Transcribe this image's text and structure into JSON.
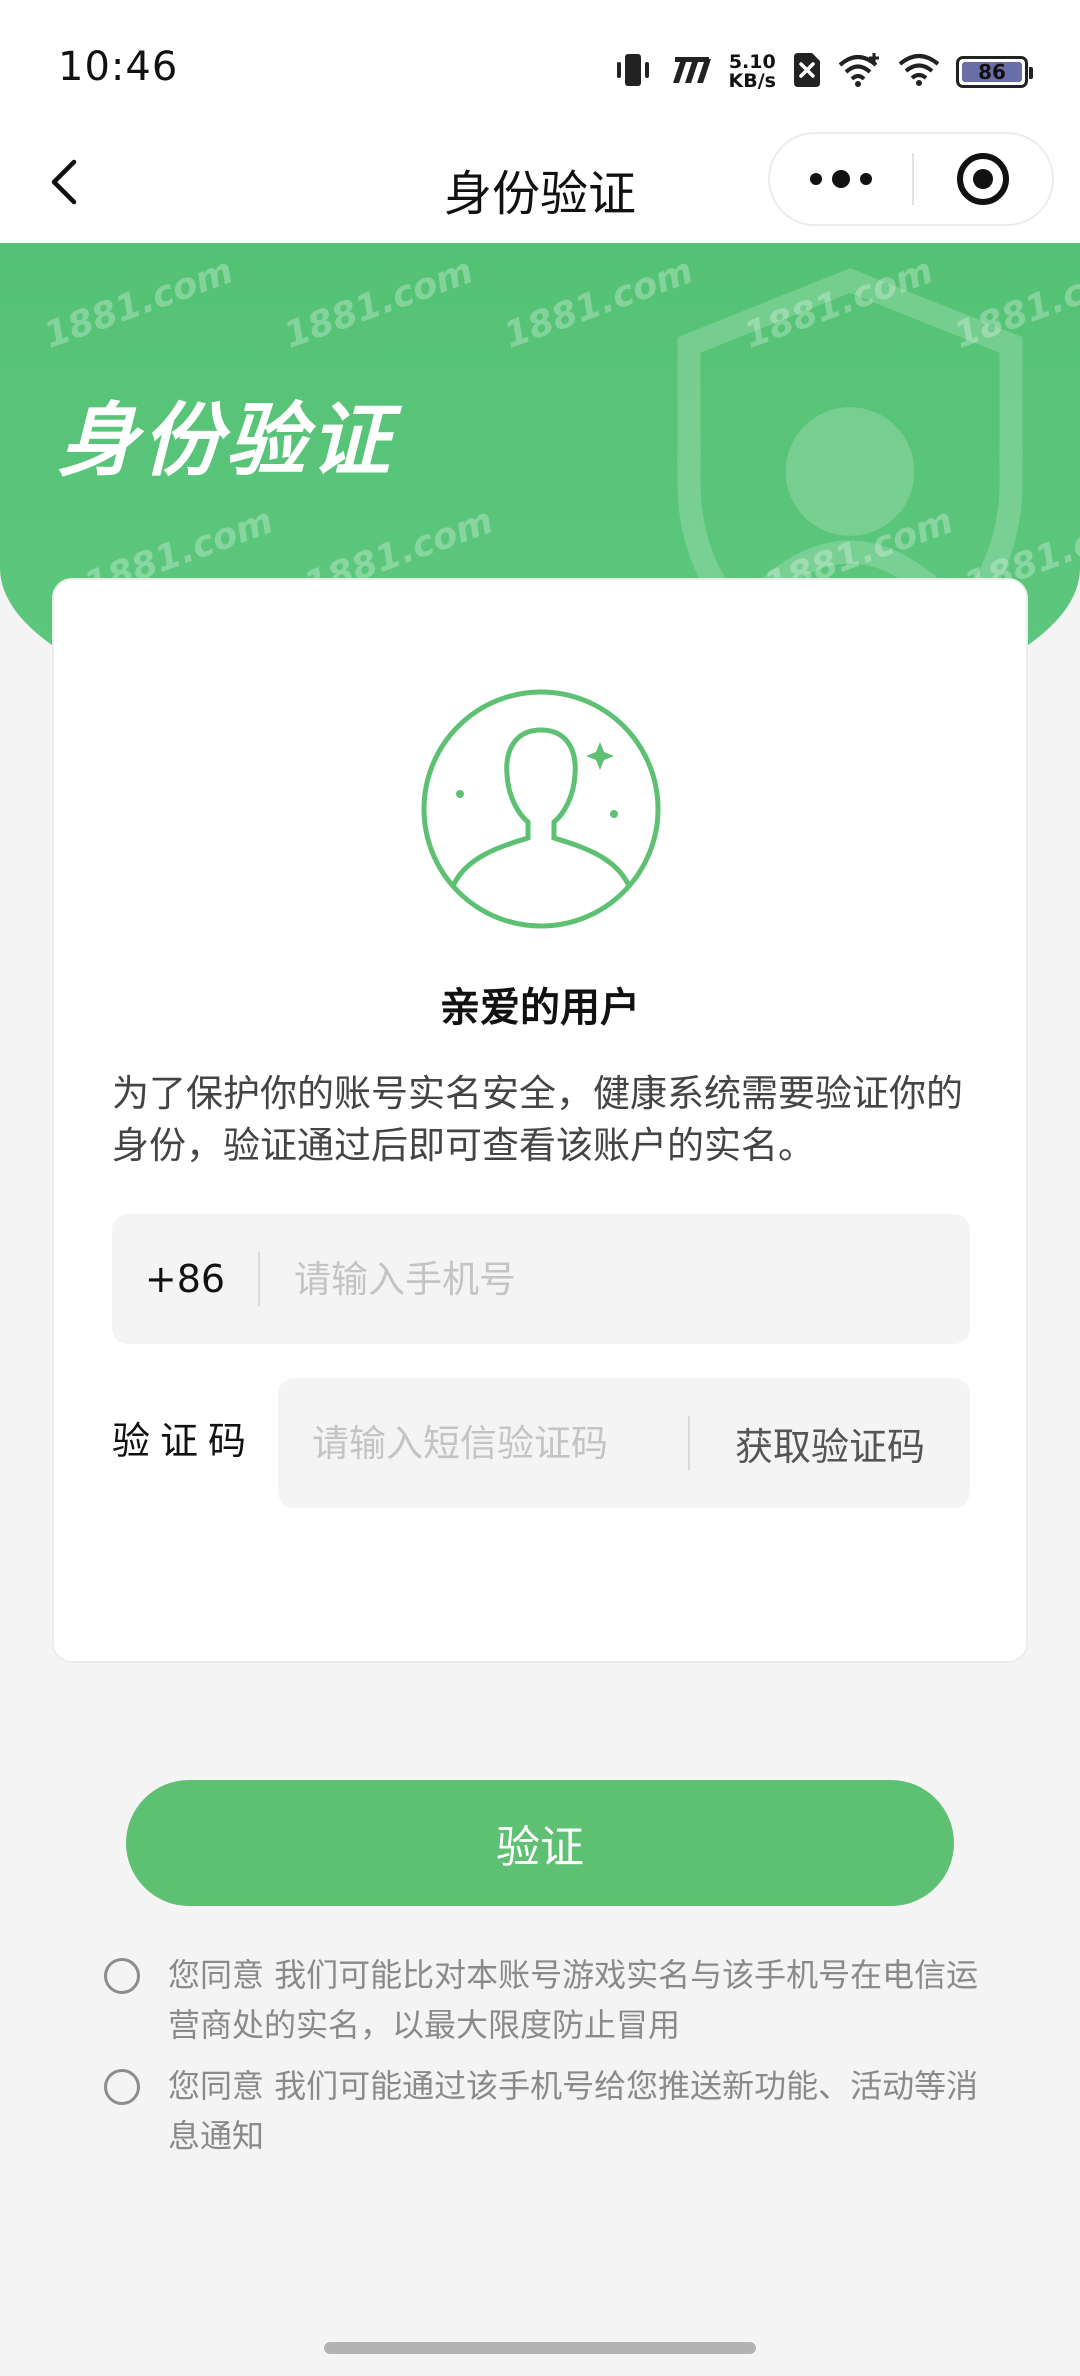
{
  "status_bar": {
    "time": "10:46",
    "net_speed_value": "5.10",
    "net_speed_unit": "KB/s",
    "battery_level": "86",
    "icons": [
      "vibrate-icon",
      "carrier-icon",
      "no-sim-icon",
      "wifi-plus-icon",
      "wifi-icon",
      "battery-icon"
    ]
  },
  "nav": {
    "title": "身份验证",
    "back_icon": "chevron-left-icon",
    "more_icon": "more-dots-icon",
    "close_icon": "target-close-icon"
  },
  "banner": {
    "title": "身份验证",
    "watermark": "1881.com"
  },
  "card": {
    "avatar_icon": "user-avatar-icon",
    "greeting": "亲爱的用户",
    "description": "为了保护你的账号实名安全，健康系统需要验证你的身份，验证通过后即可查看该账户的实名。",
    "phone": {
      "country_code": "+86",
      "value": "",
      "placeholder": "请输入手机号"
    },
    "code": {
      "label": "验证码",
      "value": "",
      "placeholder": "请输入短信验证码",
      "get_code_label": "获取验证码"
    }
  },
  "verify_button": {
    "label": "验证"
  },
  "agreements": [
    {
      "checked": false,
      "text": "您同意 我们可能比对本账号游戏实名与该手机号在电信运营商处的实名，以最大限度防止冒用"
    },
    {
      "checked": false,
      "text": "您同意 我们可能通过该手机号给您推送新功能、活动等消息通知"
    }
  ],
  "colors": {
    "brand_green": "#5dc072",
    "banner_green": "#54c274",
    "page_bg": "#f4f4f4"
  }
}
